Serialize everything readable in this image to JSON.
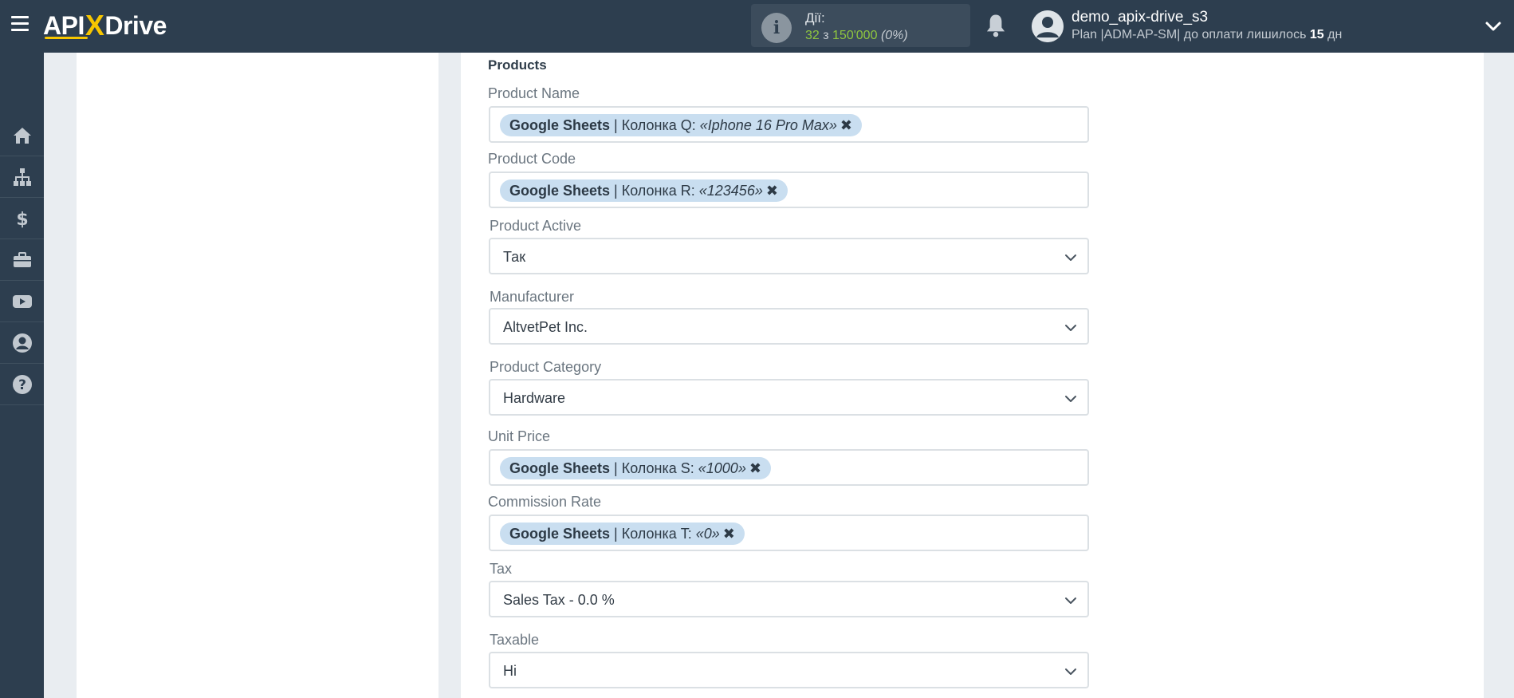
{
  "brand": {
    "logo_api": "API",
    "logo_x": "X",
    "logo_drive": "Drive"
  },
  "header": {
    "actions_title": "Дії:",
    "actions_used": "32",
    "actions_sep": " з ",
    "actions_total": "150'000",
    "actions_pct": "(0%)",
    "user_name": "demo_apix-drive_s3",
    "plan_prefix": "Plan |ADM-AP-SM| до оплати лишилось ",
    "plan_days": "15",
    "plan_suffix": " дн"
  },
  "sidebar": {
    "items": [
      {
        "icon": "home-icon"
      },
      {
        "icon": "sitemap-icon"
      },
      {
        "icon": "dollar-icon"
      },
      {
        "icon": "briefcase-icon"
      },
      {
        "icon": "youtube-icon"
      },
      {
        "icon": "user-circle-icon"
      },
      {
        "icon": "question-icon"
      }
    ]
  },
  "form": {
    "section_title": "Products",
    "fields": {
      "product_name": {
        "label": "Product Name",
        "tag_source": "Google Sheets",
        "tag_column": " | Колонка Q: ",
        "tag_value": "«Iphone 16 Pro Max»"
      },
      "product_code": {
        "label": "Product Code",
        "tag_source": "Google Sheets",
        "tag_column": " | Колонка R: ",
        "tag_value": "«123456»"
      },
      "product_active": {
        "label": "Product Active",
        "value": "Так"
      },
      "manufacturer": {
        "label": "Manufacturer",
        "value": "AltvetPet Inc."
      },
      "product_category": {
        "label": "Product Category",
        "value": "Hardware"
      },
      "unit_price": {
        "label": "Unit Price",
        "tag_source": "Google Sheets",
        "tag_column": " | Колонка S: ",
        "tag_value": "«1000»"
      },
      "commission_rate": {
        "label": "Commission Rate",
        "tag_source": "Google Sheets",
        "tag_column": " | Колонка T: ",
        "tag_value": "«0»"
      },
      "tax": {
        "label": "Tax",
        "value": "Sales Tax - 0.0 %"
      },
      "taxable": {
        "label": "Taxable",
        "value": "Ні"
      }
    },
    "remove_glyph": "✖"
  },
  "colors": {
    "topbar": "#2d3e4f",
    "accent": "#f7c600",
    "actions_green": "#8fc63f",
    "tag_bg": "#c9def0"
  }
}
